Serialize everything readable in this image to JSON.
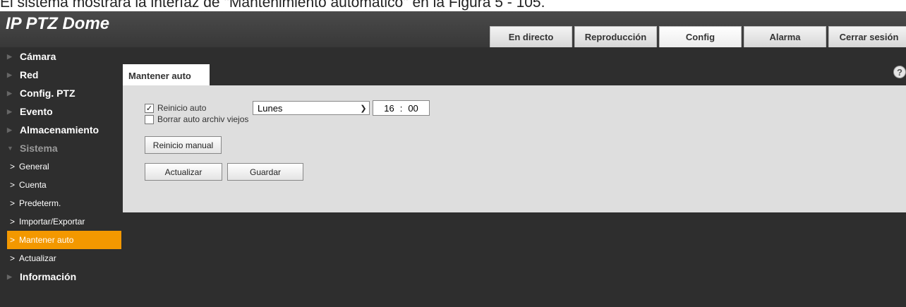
{
  "caption": "El sistema mostrará la interfaz de \"Mantenimiento automático\" en la Figura 5 - 105.",
  "app": {
    "title": "IP PTZ Dome",
    "tabs": [
      {
        "label": "En directo"
      },
      {
        "label": "Reproducción"
      },
      {
        "label": "Config"
      },
      {
        "label": "Alarma"
      },
      {
        "label": "Cerrar sesión"
      }
    ]
  },
  "sidebar": {
    "groups": [
      {
        "label": "Cámara"
      },
      {
        "label": "Red"
      },
      {
        "label": "Config. PTZ"
      },
      {
        "label": "Evento"
      },
      {
        "label": "Almacenamiento"
      },
      {
        "label": "Sistema"
      }
    ],
    "system_items": [
      {
        "label": "General"
      },
      {
        "label": "Cuenta"
      },
      {
        "label": "Predeterm."
      },
      {
        "label": "Importar/Exportar"
      },
      {
        "label": "Mantener auto"
      },
      {
        "label": "Actualizar"
      }
    ],
    "info_label": "Información"
  },
  "content": {
    "tab_label": "Mantener auto",
    "help": "?",
    "auto_reboot_label": "Reinicio auto",
    "auto_reboot_checked": true,
    "day_value": "Lunes",
    "hour": "16",
    "minute": "00",
    "time_sep": ":",
    "delete_old_label": "Borrar auto archiv viejos",
    "delete_old_checked": false,
    "manual_reboot_label": "Reinicio manual",
    "refresh_label": "Actualizar",
    "save_label": "Guardar"
  },
  "colors": {
    "accent": "#f39800",
    "sidebar_bg": "#2e2e2e",
    "panel_bg": "#dedede"
  }
}
